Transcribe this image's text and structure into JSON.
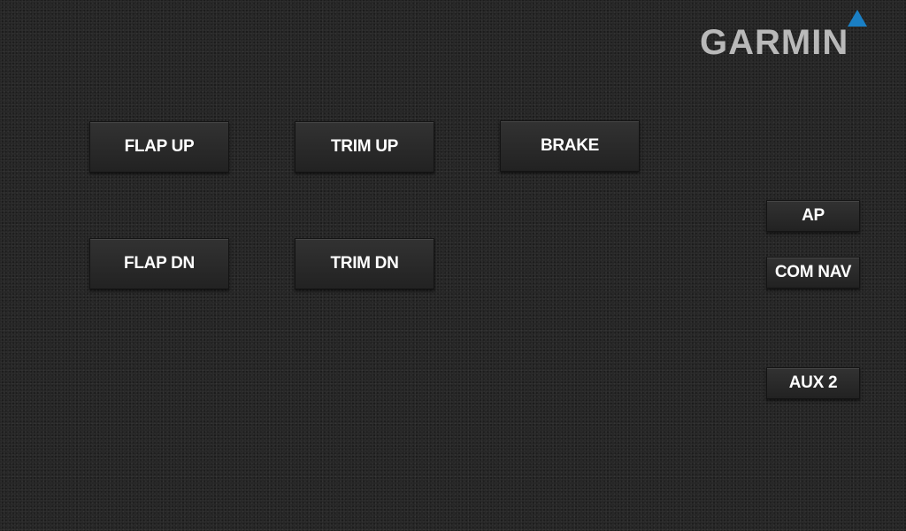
{
  "brand": {
    "logo_text": "GARMIN",
    "triangle_color": "#1a7fc4",
    "text_color": "#b9b9b9"
  },
  "buttons": {
    "flap_up": "FLAP UP",
    "trim_up": "TRIM UP",
    "brake": "BRAKE",
    "flap_dn": "FLAP DN",
    "trim_dn": "TRIM DN",
    "ap": "AP",
    "com_nav": "COM NAV",
    "aux_2": "AUX 2"
  },
  "theme": {
    "background": "#262626",
    "button_text": "#ffffff"
  }
}
